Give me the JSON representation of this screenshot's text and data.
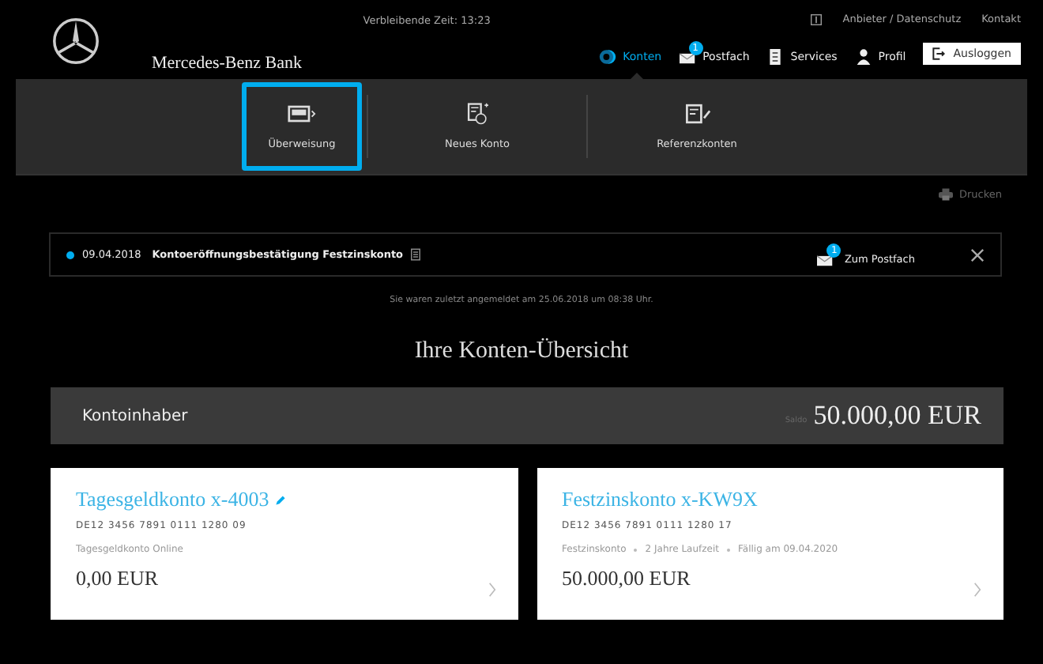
{
  "header": {
    "brand": "Mercedes-Benz Bank",
    "session": "Verbleibende Zeit: 13:23",
    "top_links": [
      "Anbieter / Datenschutz",
      "Kontakt"
    ],
    "nav": [
      {
        "label": "Konten",
        "kind": "accounts",
        "selected": true
      },
      {
        "label": "Postfach",
        "kind": "mail",
        "badge": "1",
        "selected": false
      },
      {
        "label": "Services",
        "kind": "services",
        "selected": false
      },
      {
        "label": "Profil",
        "kind": "profile",
        "selected": false
      }
    ],
    "logout": "Ausloggen"
  },
  "submenu": [
    {
      "label": "Überweisung",
      "kind": "transfer",
      "selected": true
    },
    {
      "label": "Neues Konto",
      "kind": "new",
      "selected": false
    },
    {
      "label": "Referenzkonten",
      "kind": "reference",
      "selected": false
    }
  ],
  "print": "Drucken",
  "notice": {
    "date": "09.04.2018",
    "text": "Kontoeröffnungsbestätigung Festzinskonto",
    "unread": true,
    "mail_badge": "1",
    "mail_link": "Zum Postfach"
  },
  "last_login": "Sie waren zuletzt angemeldet am 25.06.2018 um 08:38 Uhr.",
  "heading": "Ihre Konten-Übersicht",
  "owner": {
    "label": "Kontoinhaber",
    "saldo_label": "Saldo",
    "saldo": "50.000,00 EUR"
  },
  "accounts": [
    {
      "name": "Tagesgeldkonto x-4003",
      "editable": true,
      "iban": "DE12 3456 7891 0111 1280 09",
      "details": [
        "Tagesgeldkonto Online"
      ],
      "balance": "0,00 EUR"
    },
    {
      "name": "Festzinskonto x-KW9X",
      "editable": false,
      "iban": "DE12 3456 7891 0111 1280 17",
      "details": [
        "Festzinskonto",
        "2 Jahre Laufzeit",
        "Fällig am 09.04.2020"
      ],
      "balance": "50.000,00 EUR"
    }
  ]
}
